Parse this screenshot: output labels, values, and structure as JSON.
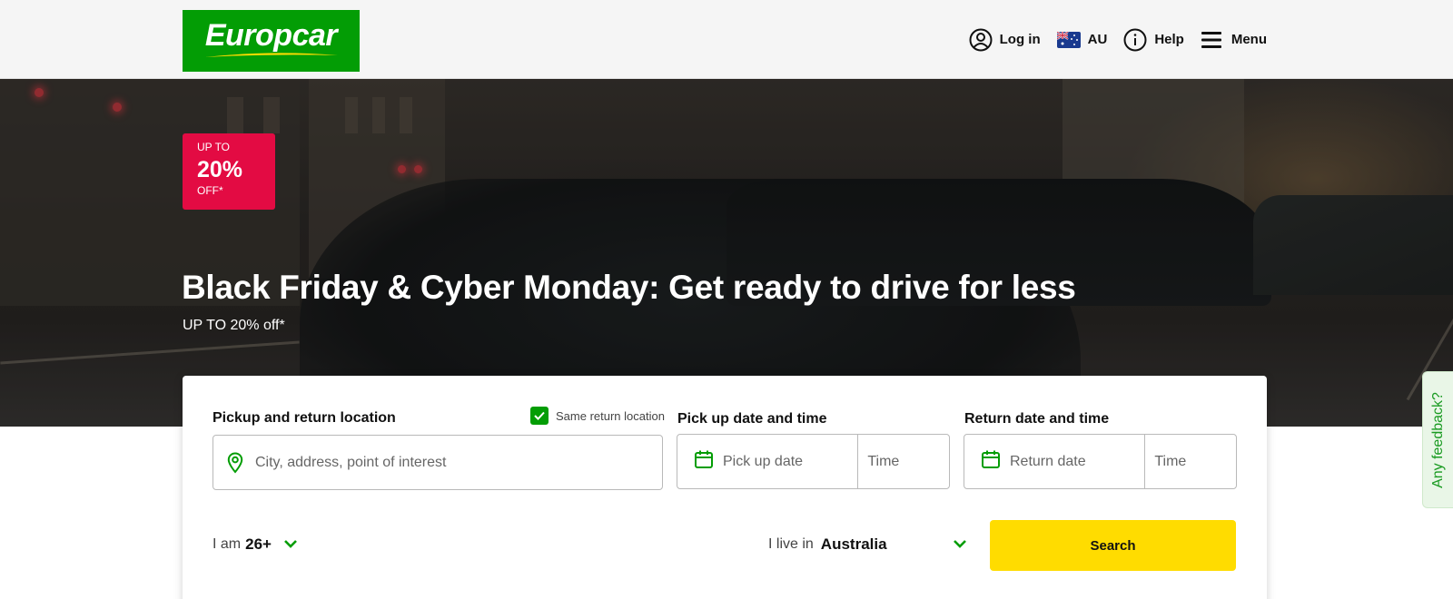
{
  "header": {
    "logo_text": "Europcar",
    "login_label": "Log in",
    "country_label": "AU",
    "help_label": "Help",
    "menu_label": "Menu"
  },
  "hero": {
    "badge_top": "UP TO",
    "badge_percent": "20%",
    "badge_bottom": "OFF*",
    "title": "Black Friday & Cyber Monday: Get ready to drive for less",
    "subtitle": "UP TO 20% off*"
  },
  "booking": {
    "pickup_location_label": "Pickup and return location",
    "same_return_label": "Same return location",
    "same_return_checked": true,
    "location_placeholder": "City, address, point of interest",
    "pickup_datetime_label": "Pick up date and time",
    "pickup_date_placeholder": "Pick up date",
    "pickup_time_placeholder": "Time",
    "return_datetime_label": "Return date and time",
    "return_date_placeholder": "Return date",
    "return_time_placeholder": "Time",
    "age_prefix": "I am",
    "age_value": "26+",
    "live_prefix": "I live in",
    "live_value": "Australia",
    "search_label": "Search"
  },
  "feedback_label": "Any feedback?",
  "colors": {
    "brand_green": "#039d05",
    "promo_red": "#e30b43",
    "search_yellow": "#ffdc00",
    "feedback_bg": "#e9f6e7"
  }
}
